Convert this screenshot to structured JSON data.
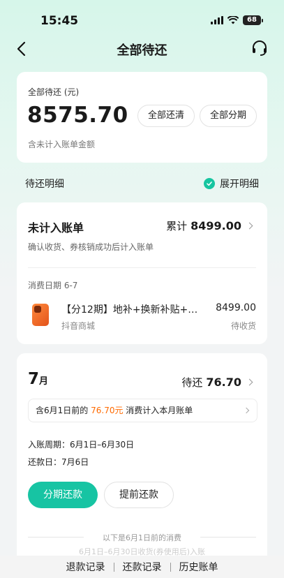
{
  "status_bar": {
    "time": "15:45",
    "battery": "68"
  },
  "nav": {
    "title": "全部待还"
  },
  "summary": {
    "label": "全部待还 (元)",
    "amount": "8575.70",
    "note": "含未计入账单金额",
    "btn_clear": "全部还清",
    "btn_installment": "全部分期"
  },
  "details_header": {
    "title": "待还明细",
    "toggle_label": "展开明细"
  },
  "unbilled": {
    "title": "未计入账单",
    "total_label": "累计",
    "total_amount": "8499.00",
    "subtitle": "确认收货、券核销成功后计入账单",
    "consume_date": "消费日期 6-7",
    "product_name": "【分12期】地补+换新补贴+12期...",
    "product_price": "8499.00",
    "store": "抖音商城",
    "status": "待收货"
  },
  "month": {
    "number": "7",
    "unit": "月",
    "due_label": "待还",
    "due_amount": "76.70",
    "notice_prefix": "含6月1日前的",
    "notice_amount": "76.70元",
    "notice_suffix": "消费计入本月账单",
    "period": "入账周期：6月1日–6月30日",
    "due_day": "还款日：7月6日",
    "btn_installment": "分期还款",
    "btn_prepay": "提前还款",
    "separator_text": "以下是6月1日前的消费",
    "faded_text": "6月1日–6月30日收货(券使用后)入账"
  },
  "bottom_links": [
    "退款记录",
    "还款记录",
    "历史账单"
  ],
  "colors": {
    "accent": "#17c4a3",
    "highlight": "#ff6a00"
  }
}
